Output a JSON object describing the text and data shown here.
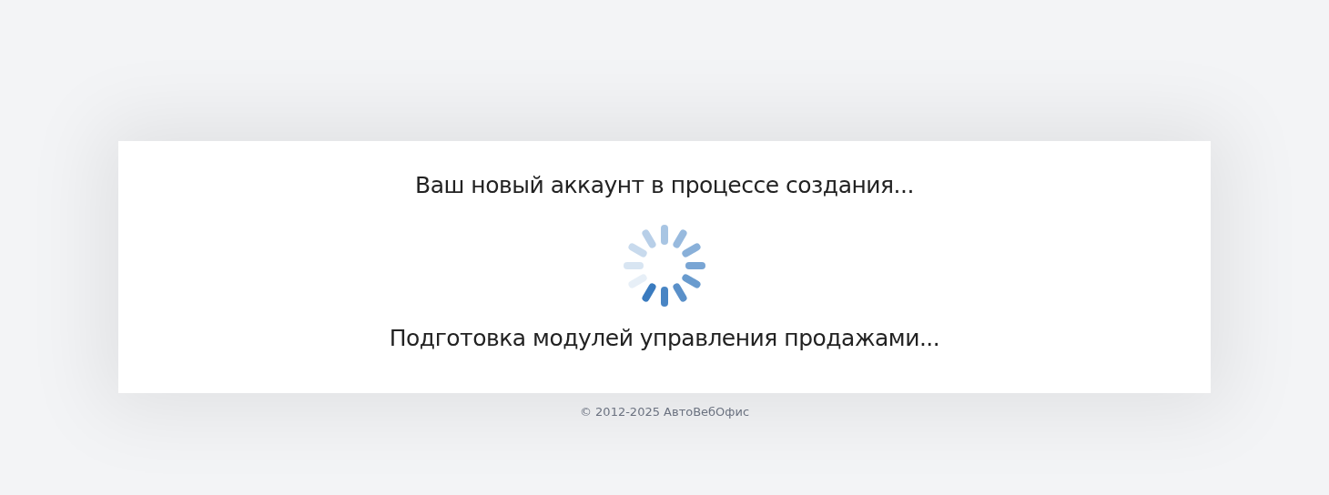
{
  "card": {
    "title": "Ваш новый аккаунт в процессе создания...",
    "status": "Подготовка модулей управления продажами..."
  },
  "footer": "© 2012-2025 АвтоВебОфис"
}
